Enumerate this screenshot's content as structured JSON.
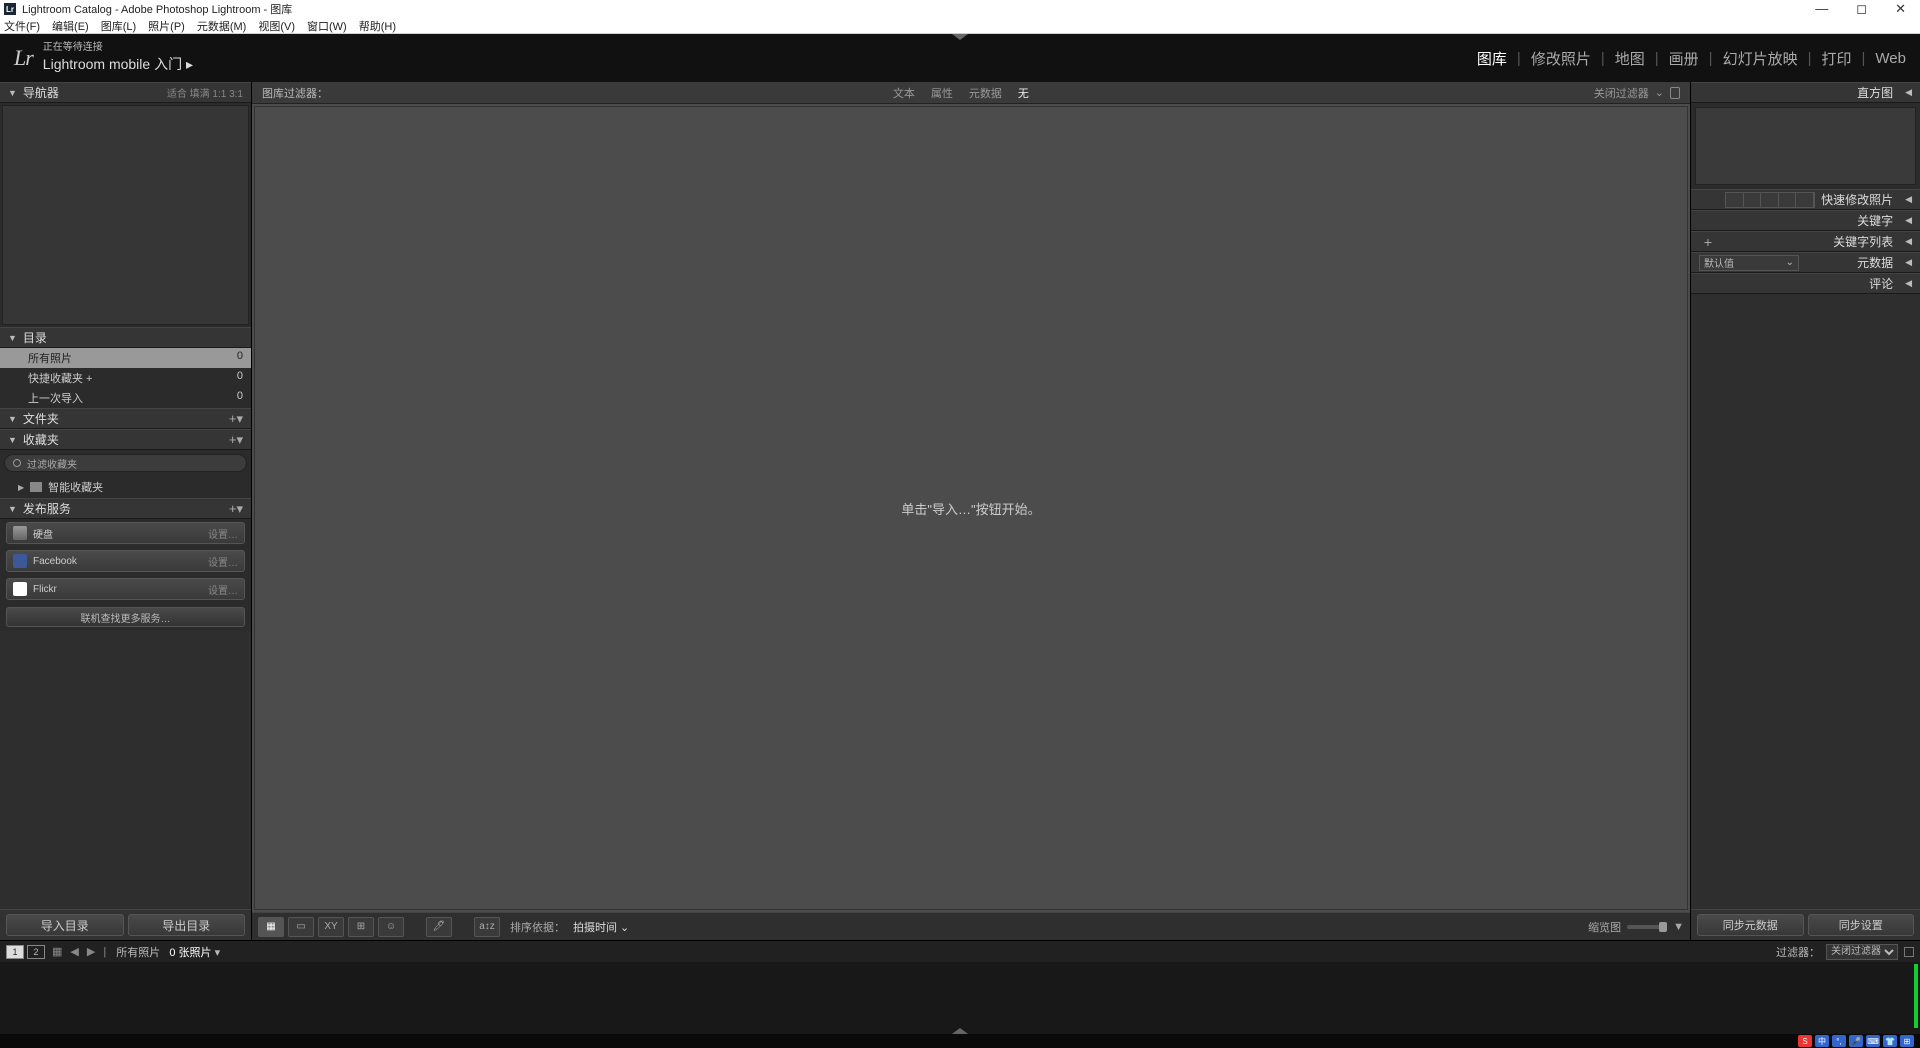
{
  "titlebar": {
    "title": "Lightroom Catalog - Adobe Photoshop Lightroom - 图库"
  },
  "menu": {
    "file": "文件(F)",
    "edit": "编辑(E)",
    "library": "图库(L)",
    "photo": "照片(P)",
    "metadata": "元数据(M)",
    "view": "视图(V)",
    "window": "窗口(W)",
    "help": "帮助(H)"
  },
  "header": {
    "status": "正在等待连接",
    "sub": "Lightroom mobile 入门",
    "arrow": "▸"
  },
  "modules": {
    "library": "图库",
    "develop": "修改照片",
    "map": "地图",
    "book": "画册",
    "slideshow": "幻灯片放映",
    "print": "打印",
    "web": "Web"
  },
  "left": {
    "navigator": {
      "title": "导航器",
      "extra": "适合  填满  1:1  3:1"
    },
    "catalog": {
      "title": "目录",
      "rows": [
        {
          "label": "所有照片",
          "count": "0"
        },
        {
          "label": "快捷收藏夹 +",
          "count": "0"
        },
        {
          "label": "上一次导入",
          "count": "0"
        }
      ]
    },
    "folders": {
      "title": "文件夹"
    },
    "collections": {
      "title": "收藏夹",
      "filter": "过滤收藏夹",
      "smart": "智能收藏夹"
    },
    "publish": {
      "title": "发布服务",
      "items": [
        {
          "label": "硬盘",
          "set": "设置…"
        },
        {
          "label": "Facebook",
          "set": "设置…"
        },
        {
          "label": "Flickr",
          "set": "设置…"
        }
      ],
      "more": "联机查找更多服务…"
    },
    "buttons": {
      "import": "导入目录",
      "export": "导出目录"
    }
  },
  "filter": {
    "label": "图库过滤器：",
    "text": "文本",
    "attr": "属性",
    "meta": "元数据",
    "none": "无",
    "off": "关闭过滤器"
  },
  "center": {
    "hint": "单击\"导入…\"按钮开始。"
  },
  "toolbar": {
    "sortlabel": "排序依据：",
    "sort": "拍摄时间",
    "thumb": "缩览图"
  },
  "right": {
    "histogram": "直方图",
    "quick": "快速修改照片",
    "keywords": "关键字",
    "keylist": "关键字列表",
    "metadata": "元数据",
    "metadefault": "默认值",
    "comments": "评论",
    "buttons": {
      "syncmeta": "同步元数据",
      "syncset": "同步设置"
    }
  },
  "fs": {
    "s1": "1",
    "s2": "2",
    "path": "所有照片",
    "count": "0 张照片",
    "flabel": "过滤器：",
    "fval": "关闭过滤器"
  }
}
